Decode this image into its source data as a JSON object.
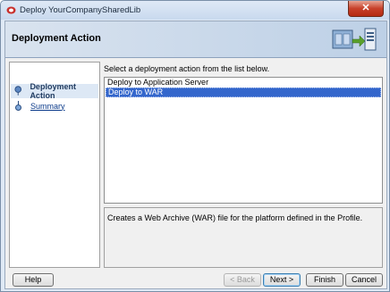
{
  "window": {
    "title": "Deploy YourCompanySharedLib",
    "close_glyph": "✕"
  },
  "header": {
    "title": "Deployment Action"
  },
  "sidebar": {
    "items": [
      {
        "label": "Deployment Action",
        "state": "active"
      },
      {
        "label": "Summary",
        "state": "link"
      }
    ]
  },
  "main": {
    "prompt": "Select a deployment action from the list below.",
    "options": [
      {
        "label": "Deploy to Application Server",
        "selected": false
      },
      {
        "label": "Deploy to WAR",
        "selected": true
      }
    ],
    "description": "Creates a Web Archive (WAR) file for the platform defined in the Profile."
  },
  "buttons": {
    "help": "Help",
    "back": "< Back",
    "next": "Next >",
    "finish": "Finish",
    "cancel": "Cancel"
  },
  "colors": {
    "selection": "#3366cc",
    "accent": "#1f3a5f"
  }
}
